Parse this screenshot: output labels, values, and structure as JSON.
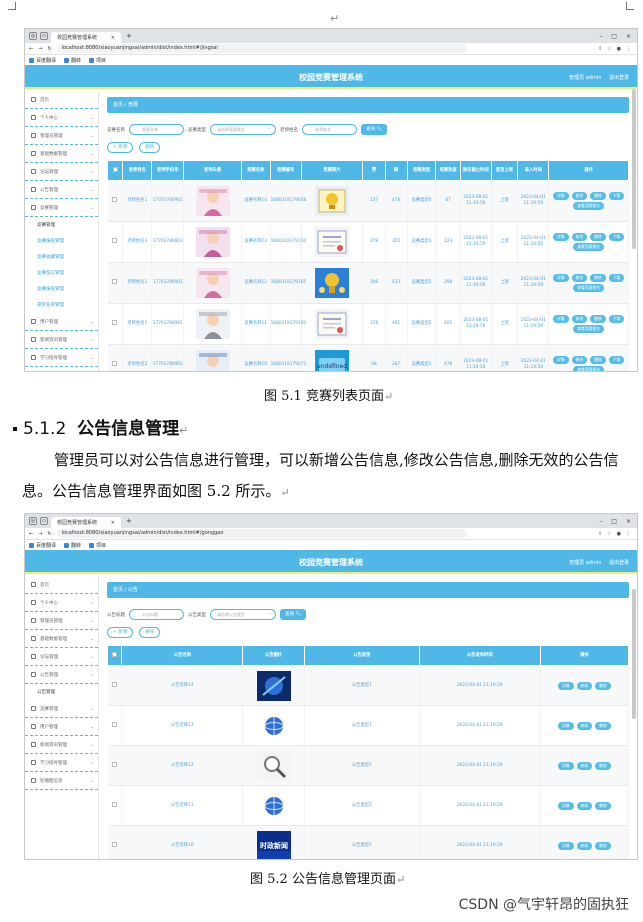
{
  "return_mark": "↵",
  "figure1": {
    "browser": {
      "tab_title": "校园竞赛管理系统",
      "url": "localhost:8080/xiaoyuanjingsai/admin/dist/index.html#/jingsai",
      "bookmarks": [
        "百度翻译",
        "翻转",
        "项目"
      ]
    },
    "app_title": "校园竞赛管理系统",
    "user_info": "管理员 admin",
    "logout": "退出登录",
    "sidebar": [
      {
        "label": "首页",
        "type": "item"
      },
      {
        "label": "个人中心",
        "type": "item"
      },
      {
        "label": "管理员管理",
        "type": "item"
      },
      {
        "label": "基础数据管理",
        "type": "item"
      },
      {
        "label": "论坛管理",
        "type": "item"
      },
      {
        "label": "公告管理",
        "type": "item"
      },
      {
        "label": "竞赛管理",
        "type": "item"
      },
      {
        "label": "竞赛管理",
        "type": "sub-active"
      },
      {
        "label": "竞赛报名管理",
        "type": "sub"
      },
      {
        "label": "竞赛收藏管理",
        "type": "sub"
      },
      {
        "label": "竞赛留言管理",
        "type": "sub"
      },
      {
        "label": "竞赛报名管理",
        "type": "sub"
      },
      {
        "label": "获奖名单管理",
        "type": "sub"
      },
      {
        "label": "用户管理",
        "type": "item"
      },
      {
        "label": "新闻资讯管理",
        "type": "item"
      },
      {
        "label": "学习指导管理",
        "type": "item"
      }
    ],
    "breadcrumb": [
      "首页",
      "竞赛"
    ],
    "filters": {
      "label1": "竞赛名称",
      "ph1": "竞赛名称",
      "label2": "竞赛类型",
      "ph2": "请选择竞赛类型",
      "label3": "老师姓名",
      "ph3": "老师姓名",
      "search": "查询"
    },
    "actions": [
      "+ 新增",
      "删除"
    ],
    "columns": [
      "",
      "老师姓名",
      "老师手机号",
      "老师头像",
      "竞赛名称",
      "竞赛编号",
      "竞赛照片",
      "赞",
      "踩",
      "竞赛类型",
      "竞赛热度",
      "报名截止时间",
      "是否上架",
      "录入时间",
      "操作"
    ],
    "rows": [
      {
        "name": "老师姓名1",
        "phone": "17703786901",
        "comp": "竞赛名称14",
        "code": "1680319179058",
        "zan": "237",
        "cai": "476",
        "type": "竞赛类型4",
        "hot": "67",
        "deadline": "2023-08-01 11:19:59",
        "onsale": "上架",
        "created": "2023-04-01 11:19:59",
        "photo": "trophy"
      },
      {
        "name": "老师姓名3",
        "phone": "17703786903",
        "comp": "竞赛名称13",
        "code": "1680319179110",
        "zan": "279",
        "cai": "355",
        "type": "竞赛类型3",
        "hot": "123",
        "deadline": "2023-08-01 11:19:59",
        "onsale": "上架",
        "created": "2023-04-01 11:19:59",
        "photo": "certificate"
      },
      {
        "name": "老师姓名1",
        "phone": "17703786901",
        "comp": "竞赛名称12",
        "code": "1680319179105",
        "zan": "306",
        "cai": "433",
        "type": "竞赛类型2",
        "hot": "298",
        "deadline": "2023-08-01 11:19:59",
        "onsale": "上架",
        "created": "2023-04-01 11:19:59",
        "photo": "cups"
      },
      {
        "name": "老师姓名1",
        "phone": "17703786901",
        "comp": "竞赛名称11",
        "code": "1680319179100",
        "zan": "378",
        "cai": "461",
        "type": "竞赛类型2",
        "hot": "201",
        "deadline": "2023-08-01 11:19:59",
        "onsale": "上架",
        "created": "2023-04-01 11:19:59",
        "photo": "certificate"
      },
      {
        "name": "老师姓名2",
        "phone": "17703786902",
        "comp": "竞赛名称10",
        "code": "1680319179072",
        "zan": "68",
        "cai": "287",
        "type": "竞赛类型1",
        "hot": "478",
        "deadline": "2023-08-01 11:19:59",
        "onsale": "上架",
        "created": "2023-04-01 11:19:59",
        "photo": "knowledge"
      }
    ],
    "row_ops": [
      "详情",
      "修改",
      "删除",
      "下载",
      "查看竞赛报名"
    ],
    "caption": "图 5.1  竞赛列表页面"
  },
  "section": {
    "number": "5.1.2",
    "title": "公告信息管理",
    "paragraph": "管理员可以对公告信息进行管理，可以新增公告信息,修改公告信息,删除无效的公告信息。公告信息管理界面如图 5.2 所示。"
  },
  "figure2": {
    "browser": {
      "tab_title": "校园竞赛管理系统",
      "url": "localhost:8080/xiaoyuanjingsai/admin/dist/index.html#/gonggao",
      "bookmarks": [
        "百度翻译",
        "翻转",
        "项目"
      ]
    },
    "app_title": "校园竞赛管理系统",
    "user_info": "管理员 admin",
    "logout": "退出登录",
    "sidebar": [
      {
        "label": "首页",
        "type": "item"
      },
      {
        "label": "个人中心",
        "type": "item"
      },
      {
        "label": "管理员管理",
        "type": "item"
      },
      {
        "label": "基础数据管理",
        "type": "item"
      },
      {
        "label": "论坛管理",
        "type": "item"
      },
      {
        "label": "公告管理",
        "type": "item"
      },
      {
        "label": "公告管理",
        "type": "sub-active"
      },
      {
        "label": "竞赛管理",
        "type": "item"
      },
      {
        "label": "用户管理",
        "type": "item"
      },
      {
        "label": "新闻资讯管理",
        "type": "item"
      },
      {
        "label": "学习指导管理",
        "type": "item"
      },
      {
        "label": "轮播图信息",
        "type": "item"
      }
    ],
    "breadcrumb": [
      "首页",
      "公告"
    ],
    "filters": {
      "label1": "公告标题",
      "ph1": "公告标题",
      "label2": "公告类型",
      "ph2": "请选择公告类型",
      "search": "查询"
    },
    "actions": [
      "+ 新增",
      "删除"
    ],
    "columns": [
      "",
      "公告名称",
      "公告图片",
      "公告类型",
      "公告发布时间",
      "操作"
    ],
    "rows": [
      {
        "name": "公告名称14",
        "type": "公告类型1",
        "time": "2023-04-01 11:19:29",
        "photo": "blue"
      },
      {
        "name": "公告名称13",
        "type": "公告类型1",
        "time": "2023-04-01 11:19:29",
        "photo": "globe"
      },
      {
        "name": "公告名称12",
        "type": "公告类型2",
        "time": "2023-04-01 11:19:29",
        "photo": "magnifier"
      },
      {
        "name": "公告名称11",
        "type": "公告类型2",
        "time": "2023-04-01 11:19:29",
        "photo": "globe"
      },
      {
        "name": "公告名称10",
        "type": "公告类型2",
        "time": "2023-04-01 11:19:29",
        "photo": "news"
      }
    ],
    "row_ops": [
      "详情",
      "修改",
      "删除"
    ],
    "news_thumb_text": "时政新闻",
    "knowledge_thumb_text": "知识竞赛",
    "caption": "图 5.2  公告信息管理页面"
  },
  "watermark": "CSDN @气宇轩昂的固执狂"
}
